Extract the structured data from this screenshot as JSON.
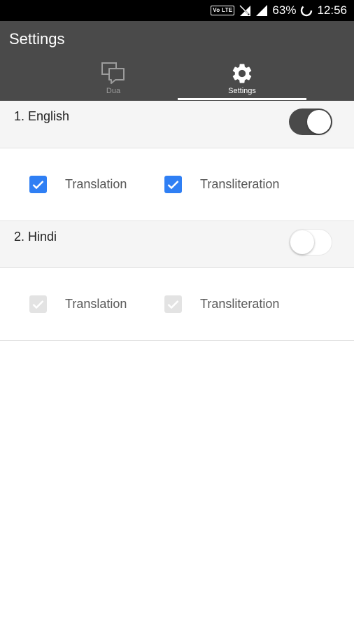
{
  "status_bar": {
    "network_badge": "Vo LTE",
    "battery": "63%",
    "time": "12:56"
  },
  "appbar": {
    "title": "Settings",
    "tabs": [
      {
        "label": "Dua",
        "icon": "chat-bubbles-icon",
        "selected": false
      },
      {
        "label": "Settings",
        "icon": "gear-icon",
        "selected": true
      }
    ]
  },
  "sections": [
    {
      "label": "1. English",
      "toggle_on": true,
      "options": [
        {
          "label": "Translation",
          "checked": true,
          "enabled": true
        },
        {
          "label": "Transliteration",
          "checked": true,
          "enabled": true
        }
      ]
    },
    {
      "label": "2. Hindi",
      "toggle_on": false,
      "options": [
        {
          "label": "Translation",
          "checked": true,
          "enabled": false
        },
        {
          "label": "Transliteration",
          "checked": true,
          "enabled": false
        }
      ]
    }
  ],
  "colors": {
    "appbar": "#4a4a4a",
    "accent": "#2f7ff4",
    "disabled_check": "#e3e3e3"
  }
}
